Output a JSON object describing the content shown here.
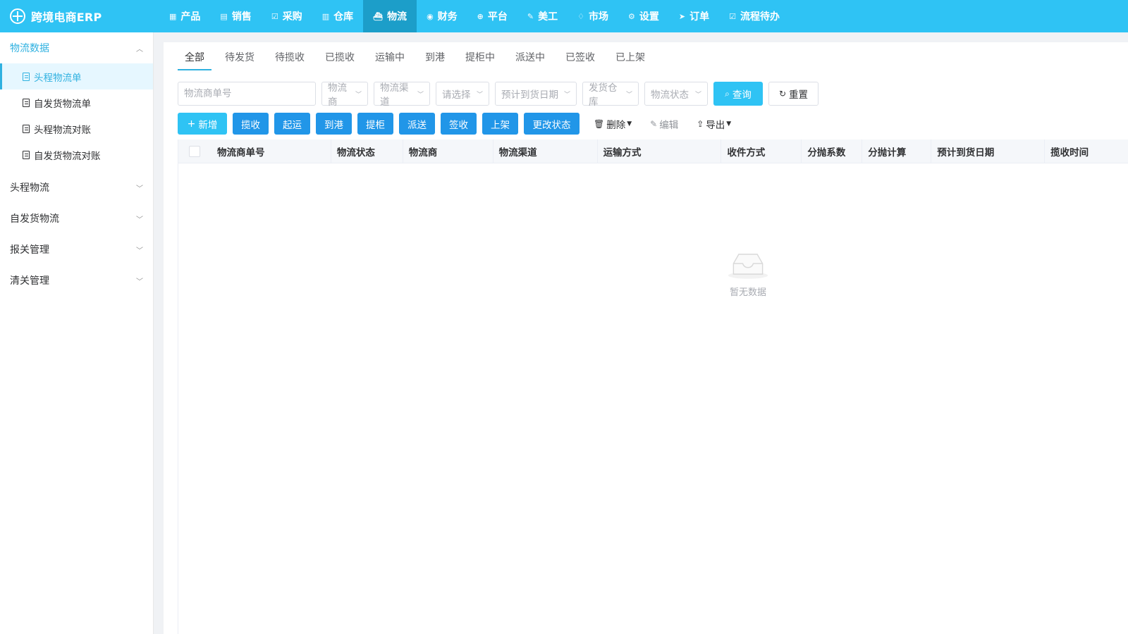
{
  "brand": {
    "title": "跨境电商ERP"
  },
  "nav": {
    "items": [
      {
        "label": "产品",
        "icon": "grid-icon"
      },
      {
        "label": "销售",
        "icon": "store-icon"
      },
      {
        "label": "采购",
        "icon": "cart-check-icon"
      },
      {
        "label": "仓库",
        "icon": "building-icon"
      },
      {
        "label": "物流",
        "icon": "ship-icon",
        "active": true
      },
      {
        "label": "财务",
        "icon": "coin-icon"
      },
      {
        "label": "平台",
        "icon": "globe-icon"
      },
      {
        "label": "美工",
        "icon": "edit-icon"
      },
      {
        "label": "市场",
        "icon": "shirt-icon"
      },
      {
        "label": "设置",
        "icon": "gear-icon"
      },
      {
        "label": "订单",
        "icon": "send-icon"
      },
      {
        "label": "流程待办",
        "icon": "checkbox-icon"
      }
    ]
  },
  "sidebar": {
    "groups": [
      {
        "label": "物流数据",
        "open": true,
        "items": [
          {
            "label": "头程物流单",
            "active": true
          },
          {
            "label": "自发货物流单"
          },
          {
            "label": "头程物流对账"
          },
          {
            "label": "自发货物流对账"
          }
        ]
      },
      {
        "label": "头程物流"
      },
      {
        "label": "自发货物流"
      },
      {
        "label": "报关管理"
      },
      {
        "label": "清关管理"
      }
    ]
  },
  "tabs": [
    "全部",
    "待发货",
    "待揽收",
    "已揽收",
    "运输中",
    "到港",
    "提柜中",
    "派送中",
    "已签收",
    "已上架"
  ],
  "filters": {
    "tracking_placeholder": "物流商单号",
    "carrier": "物流商",
    "channel": "物流渠道",
    "select": "请选择",
    "eta": "预计到货日期",
    "warehouse": "发货仓库",
    "status": "物流状态",
    "query": "查询",
    "reset": "重置"
  },
  "actions": {
    "add": "新增",
    "collect": "揽收",
    "depart": "起运",
    "arrive": "到港",
    "pickup": "提柜",
    "deliver": "派送",
    "sign": "签收",
    "shelve": "上架",
    "change_status": "更改状态",
    "delete": "删除",
    "edit": "编辑",
    "export": "导出"
  },
  "table": {
    "columns": [
      "物流商单号",
      "物流状态",
      "物流商",
      "物流渠道",
      "运输方式",
      "收件方式",
      "分抛系数",
      "分抛计算",
      "预计到货日期",
      "揽收时间"
    ],
    "empty_text": "暂无数据"
  },
  "colors": {
    "primary": "#2fc3f4",
    "nav_active": "#1c9ec9",
    "button_blue": "#2196e8",
    "accent_text": "#2fb1e0"
  }
}
